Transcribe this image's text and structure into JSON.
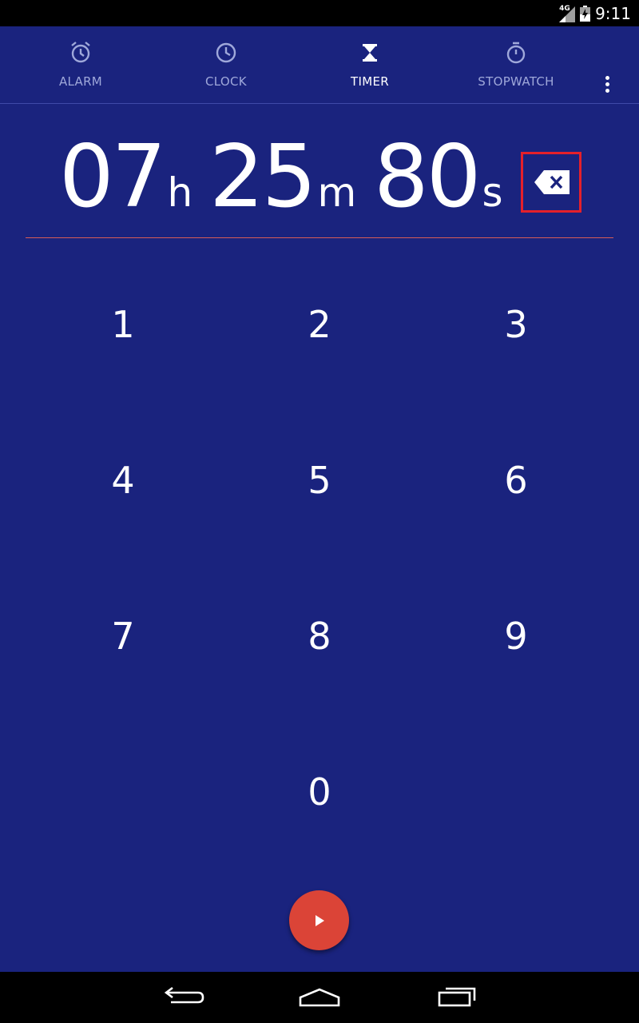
{
  "status_bar": {
    "network": "4G",
    "time": "9:11"
  },
  "tabs": [
    {
      "label": "ALARM",
      "icon": "alarm-icon",
      "active": false
    },
    {
      "label": "CLOCK",
      "icon": "clock-icon",
      "active": false
    },
    {
      "label": "TIMER",
      "icon": "hourglass-icon",
      "active": true
    },
    {
      "label": "STOPWATCH",
      "icon": "stopwatch-icon",
      "active": false
    }
  ],
  "timer_display": {
    "hours": "07",
    "hours_unit": "h",
    "minutes": "25",
    "minutes_unit": "m",
    "seconds": "80",
    "seconds_unit": "s"
  },
  "keypad": {
    "keys": [
      "1",
      "2",
      "3",
      "4",
      "5",
      "6",
      "7",
      "8",
      "9",
      "0"
    ]
  },
  "colors": {
    "background": "#1a237e",
    "accent": "#db4437",
    "highlight_box": "#e5202a",
    "inactive_tab": "#9fa8da"
  },
  "icons": {
    "delete": "backspace-icon",
    "start": "play-icon",
    "menu": "more-vert-icon",
    "nav_back": "back-icon",
    "nav_home": "home-icon",
    "nav_recents": "recents-icon"
  }
}
